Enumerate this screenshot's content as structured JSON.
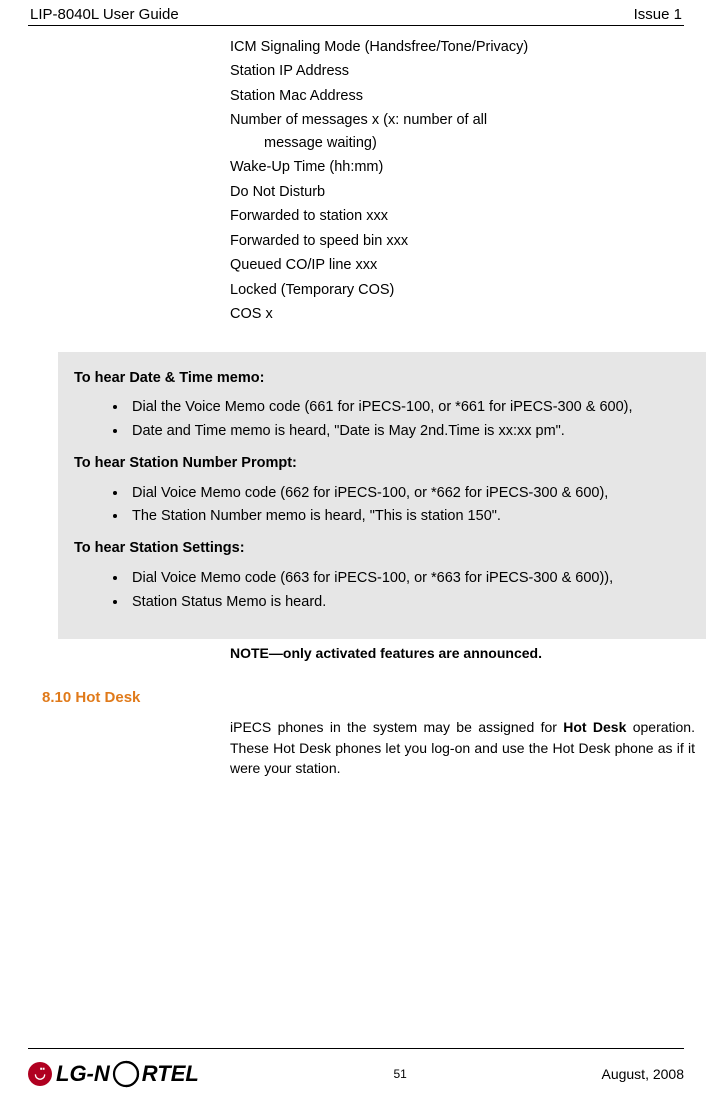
{
  "header": {
    "left": "LIP-8040L User Guide",
    "right": "Issue 1"
  },
  "features": {
    "items": [
      "ICM Signaling Mode (Handsfree/Tone/Privacy)",
      "Station IP Address",
      "Station Mac Address"
    ],
    "wrapped": {
      "line1": "Number of messages x (x: number of all",
      "line2": "message waiting)"
    },
    "items2": [
      "Wake-Up Time (hh:mm)",
      "Do Not Disturb",
      "Forwarded to station xxx",
      "Forwarded to speed bin xxx",
      "Queued CO/IP line xxx",
      "Locked (Temporary COS)",
      "COS x"
    ]
  },
  "callout": {
    "head1": "To hear Date & Time memo:",
    "list1": [
      "Dial the Voice Memo code (661 for iPECS-100, or *661 for iPECS-300 & 600),",
      "Date and Time memo is heard, \"Date is May 2nd.Time is xx:xx pm\"."
    ],
    "head2": "To hear Station Number Prompt:",
    "list2": [
      "Dial Voice Memo code (662 for iPECS-100, or *662 for iPECS-300 & 600),",
      "The Station Number memo is heard, \"This is station 150\"."
    ],
    "head3": "To hear Station Settings:",
    "list3": [
      "Dial Voice Memo code (663 for iPECS-100, or *663 for iPECS-300 & 600)),",
      "Station Status Memo is heard."
    ]
  },
  "note": "NOTE—only activated features are announced.",
  "section": {
    "number": "8.10",
    "title": "Hot Desk",
    "label": "8.10  Hot Desk"
  },
  "body": {
    "p1_a": "iPECS phones in the system may be assigned for ",
    "p1_bold": "Hot Desk",
    "p1_b": " operation.  These Hot Desk phones let you log-on and use the Hot Desk phone as if it were your station."
  },
  "footer": {
    "logo_a": "LG-N",
    "logo_b": "RTEL",
    "page": "51",
    "date": "August, 2008"
  }
}
